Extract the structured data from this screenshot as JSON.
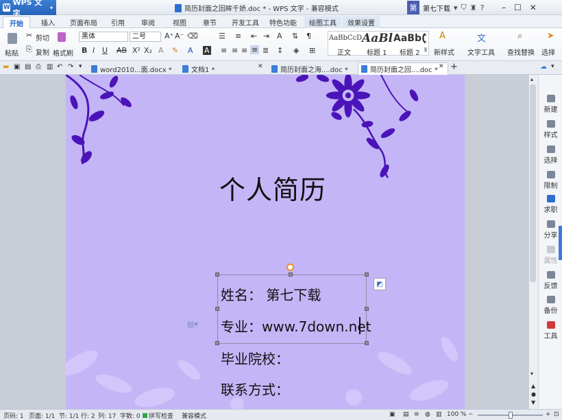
{
  "titlebar": {
    "app_button": "WPS 文字",
    "doc_title": "简历封面之回眸千娇.doc * - WPS 文字 - 兼容模式",
    "account_badge": "第",
    "account_name": "第七下载"
  },
  "menu_tabs": [
    "开始",
    "插入",
    "页面布局",
    "引用",
    "审阅",
    "视图",
    "章节",
    "开发工具",
    "特色功能",
    "绘图工具",
    "效果设置"
  ],
  "ribbon": {
    "paste": "粘贴",
    "cut": "剪切",
    "copy": "复制",
    "format_painter": "格式刷",
    "font_name": "黑体",
    "font_size": "二号",
    "styles": [
      {
        "preview": "AaBbCcD",
        "name": "正文"
      },
      {
        "preview": "AaBl",
        "name": "标题 1"
      },
      {
        "preview": "AaBb(",
        "name": "标题 2"
      }
    ],
    "new_style": "新样式",
    "text_tools": "文字工具",
    "find_replace": "查找替换",
    "select": "选择"
  },
  "doc_tabs": [
    {
      "label": "word2010...面.docx *"
    },
    {
      "label": "文档1 *"
    },
    {
      "label": "简历封面之海....doc *"
    },
    {
      "label": "简历封面之回....doc *"
    }
  ],
  "document": {
    "title": "个人简历",
    "fields": [
      "姓名：  第七下载",
      "专业：www.7down.net",
      "毕业院校：",
      "联系方式："
    ]
  },
  "right_panel": [
    "新建",
    "样式",
    "选择",
    "限制",
    "求职",
    "分享",
    "属性",
    "反馈",
    "备份",
    "工具"
  ],
  "statusbar": {
    "page_no": "页码: 1",
    "pages": "页面: 1/1",
    "section": "节: 1/1",
    "row": "行: 2",
    "col": "列: 17",
    "words": "字数: 0",
    "spell": "拼写检查",
    "compat": "兼容模式",
    "zoom": "100 %"
  },
  "colors": {
    "page_bg": "#c4b5f7",
    "flower": "#4a14b8",
    "accent": "#2563b8"
  }
}
